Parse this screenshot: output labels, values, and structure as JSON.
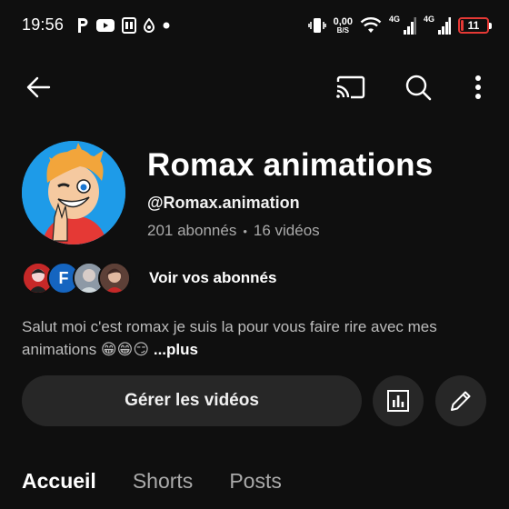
{
  "status_bar": {
    "time": "19:56",
    "left_icons": [
      "parking-icon",
      "youtube-icon",
      "pdf-icon",
      "drop-icon",
      "dot-icon"
    ],
    "speed_value": "0,00",
    "speed_unit": "B/S",
    "network_1": "4G",
    "network_2": "4G",
    "battery_level": "11",
    "battery_color": "#e53935"
  },
  "app_bar": {
    "icons": [
      "back-arrow-icon",
      "cast-icon",
      "search-icon",
      "more-vert-icon"
    ]
  },
  "channel": {
    "name": "Romax animations",
    "handle": "@Romax.animation",
    "subscribers": "201 abonnés",
    "separator": "•",
    "videos": "16 vidéos"
  },
  "subscribers_preview": {
    "initial": "F",
    "link_text": "Voir vos abonnés"
  },
  "description": {
    "text": "Salut moi c'est romax je suis la pour vous faire rire avec mes animations 😁😁😏",
    "more_label": "...plus"
  },
  "actions": {
    "manage_label": "Gérer les vidéos"
  },
  "tabs": [
    {
      "label": "Accueil",
      "active": true
    },
    {
      "label": "Shorts",
      "active": false
    },
    {
      "label": "Posts",
      "active": false
    }
  ],
  "colors": {
    "background": "#0f0f0f",
    "button_bg": "#272727",
    "secondary_text": "#aaaaaa",
    "avatar_bg": "#1e9be8"
  }
}
